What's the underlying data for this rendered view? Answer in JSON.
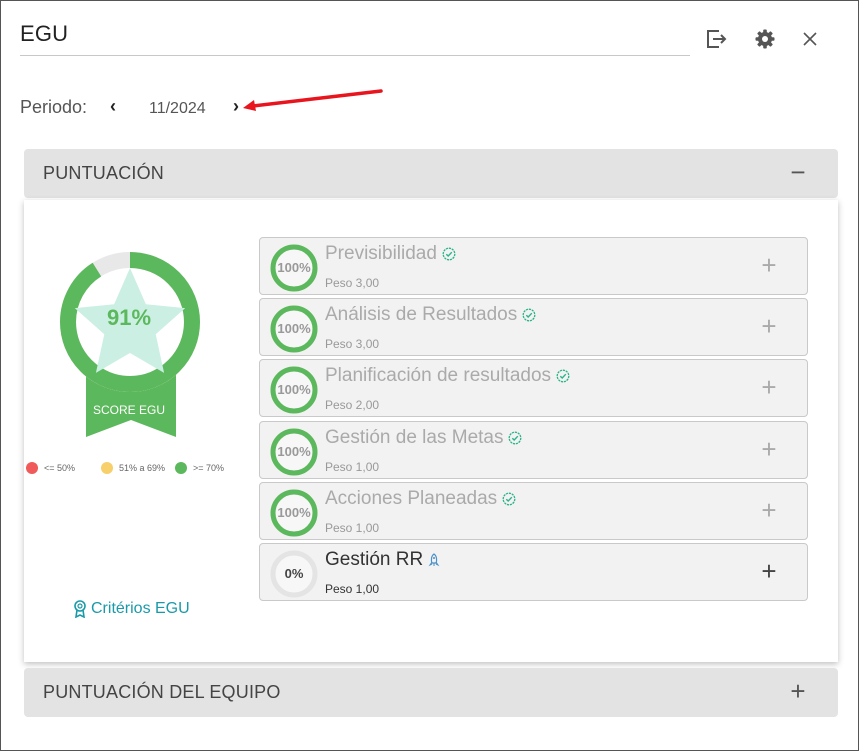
{
  "header": {
    "title": "EGU",
    "icons": {
      "export": "export-icon",
      "settings": "gear-icon",
      "close": "close-icon"
    }
  },
  "period": {
    "label": "Periodo:",
    "value": "11/2024",
    "prev_icon": "chevron-left-icon",
    "next_icon": "chevron-right-icon"
  },
  "sections": {
    "score": {
      "title": "PUNTUACIÓN",
      "toggle": "−"
    },
    "team": {
      "title": "PUNTUACIÓN DEL EQUIPO",
      "toggle": "+"
    }
  },
  "score_badge": {
    "percent": "91%",
    "percent_value": 91,
    "label": "SCORE EGU"
  },
  "legend": [
    {
      "label": "<= 50%",
      "color": "#f05a5a"
    },
    {
      "label": "51% a 69%",
      "color": "#f7cf6b"
    },
    {
      "label": ">= 70%",
      "color": "#5cb85c"
    }
  ],
  "criteria_link": "Critérios EGU",
  "items": [
    {
      "name": "Previsibilidad",
      "percent": "100%",
      "value": 100,
      "weight": "Peso 3,00",
      "status_icon": "verified-badge-icon",
      "plus": "+"
    },
    {
      "name": "Análisis de Resultados",
      "percent": "100%",
      "value": 100,
      "weight": "Peso 3,00",
      "status_icon": "verified-badge-icon",
      "plus": "+"
    },
    {
      "name": "Planificación de resultados",
      "percent": "100%",
      "value": 100,
      "weight": "Peso 2,00",
      "status_icon": "verified-badge-icon",
      "plus": "+"
    },
    {
      "name": "Gestión de las Metas",
      "percent": "100%",
      "value": 100,
      "weight": "Peso 1,00",
      "status_icon": "verified-badge-icon",
      "plus": "+"
    },
    {
      "name": "Acciones Planeadas",
      "percent": "100%",
      "value": 100,
      "weight": "Peso 1,00",
      "status_icon": "verified-badge-icon",
      "plus": "+"
    },
    {
      "name": "Gestión RR",
      "percent": "0%",
      "value": 0,
      "weight": "Peso 1,00",
      "status_icon": "rocket-icon",
      "plus": "+"
    }
  ],
  "colors": {
    "green": "#5cb85c",
    "teal": "#1a9aa8",
    "verified": "#2bb38a",
    "annotation_red": "#e8141e"
  }
}
